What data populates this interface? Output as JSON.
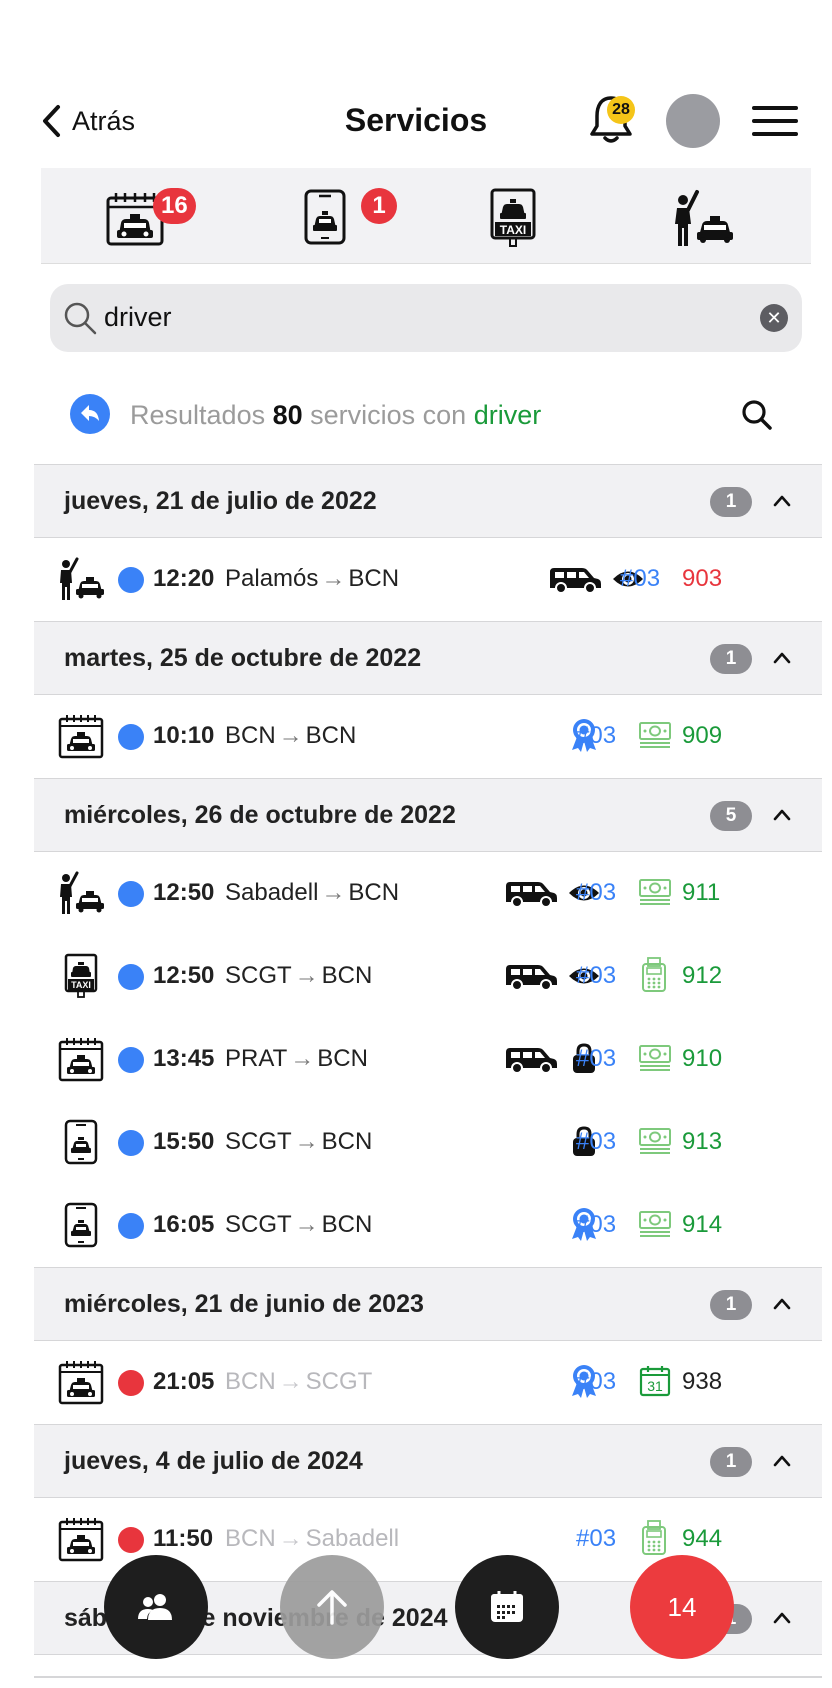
{
  "header": {
    "back_label": "Atrás",
    "title": "Servicios",
    "notifications_count": "28"
  },
  "categories": [
    {
      "icon": "calendar-taxi-icon",
      "badge": "16"
    },
    {
      "icon": "phone-taxi-icon",
      "badge": "1"
    },
    {
      "icon": "taxi-stand-icon",
      "badge": ""
    },
    {
      "icon": "street-hail-taxi-icon",
      "badge": ""
    }
  ],
  "search": {
    "value": "driver"
  },
  "results": {
    "prefix": "Resultados ",
    "count": "80",
    "middle": " servicios con ",
    "keyword": "driver"
  },
  "colors": {
    "blue": "#3a82f7",
    "red": "#e8353d",
    "green": "#1a9a3a",
    "light_green": "#7ec97c"
  },
  "groups": [
    {
      "date": "jueves, 21 de julio de 2022",
      "count": "1",
      "rows": [
        {
          "type_icon": "street-hail-taxi-icon",
          "status": "blue",
          "time": "12:20",
          "from": "Palamós",
          "to": "BCN",
          "muted": false,
          "van": true,
          "badge": "eye",
          "code": "#03",
          "pay": "",
          "number": "903",
          "number_color": "red"
        }
      ]
    },
    {
      "date": "martes, 25 de octubre de 2022",
      "count": "1",
      "rows": [
        {
          "type_icon": "calendar-taxi-icon",
          "status": "blue",
          "time": "10:10",
          "from": "BCN",
          "to": "BCN",
          "muted": false,
          "van": false,
          "badge": "award",
          "code": "#03",
          "pay": "cash",
          "number": "909",
          "number_color": "green"
        }
      ]
    },
    {
      "date": "miércoles, 26 de octubre de 2022",
      "count": "5",
      "rows": [
        {
          "type_icon": "street-hail-taxi-icon",
          "status": "blue",
          "time": "12:50",
          "from": "Sabadell",
          "to": "BCN",
          "muted": false,
          "van": true,
          "badge": "eye",
          "code": "#03",
          "pay": "cash",
          "number": "911",
          "number_color": "green"
        },
        {
          "type_icon": "taxi-stand-icon",
          "status": "blue",
          "time": "12:50",
          "from": "SCGT",
          "to": "BCN",
          "muted": false,
          "van": true,
          "badge": "eye",
          "code": "#03",
          "pay": "terminal",
          "number": "912",
          "number_color": "green"
        },
        {
          "type_icon": "calendar-taxi-icon",
          "status": "blue",
          "time": "13:45",
          "from": "PRAT",
          "to": "BCN",
          "muted": false,
          "van": true,
          "badge": "lock",
          "code": "#03",
          "pay": "cash",
          "number": "910",
          "number_color": "green"
        },
        {
          "type_icon": "phone-taxi-icon",
          "status": "blue",
          "time": "15:50",
          "from": "SCGT",
          "to": "BCN",
          "muted": false,
          "van": false,
          "badge": "lock",
          "code": "#03",
          "pay": "cash",
          "number": "913",
          "number_color": "green"
        },
        {
          "type_icon": "phone-taxi-icon",
          "status": "blue",
          "time": "16:05",
          "from": "SCGT",
          "to": "BCN",
          "muted": false,
          "van": false,
          "badge": "award",
          "code": "#03",
          "pay": "cash",
          "number": "914",
          "number_color": "green"
        }
      ]
    },
    {
      "date": "miércoles, 21 de junio de 2023",
      "count": "1",
      "rows": [
        {
          "type_icon": "calendar-taxi-icon",
          "status": "red",
          "time": "21:05",
          "from": "BCN",
          "to": "SCGT",
          "muted": true,
          "van": false,
          "badge": "award",
          "code": "#03",
          "pay": "calendar",
          "number": "938",
          "number_color": "dark",
          "calendar_day": "31"
        }
      ]
    },
    {
      "date": "jueves, 4 de julio de 2024",
      "count": "1",
      "rows": [
        {
          "type_icon": "calendar-taxi-icon",
          "status": "red",
          "time": "11:50",
          "from": "BCN",
          "to": "Sabadell",
          "muted": true,
          "van": false,
          "badge": "",
          "code": "#03",
          "pay": "terminal",
          "number": "944",
          "number_color": "green"
        }
      ]
    },
    {
      "date": "sábado, 2 de noviembre de 2024",
      "count": "1",
      "rows": []
    }
  ],
  "fabs": {
    "users_icon": "users-icon",
    "up_icon": "arrow-up-icon",
    "calendar_icon": "calendar-icon",
    "count": "14"
  }
}
